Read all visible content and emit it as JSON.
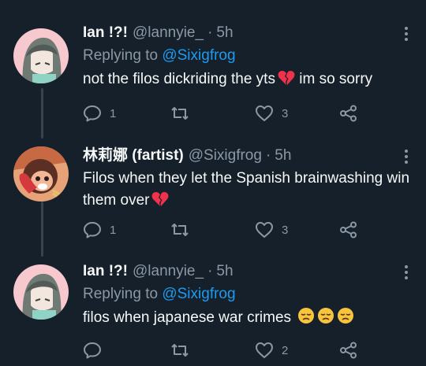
{
  "colors": {
    "background": "#15202b",
    "text": "#f7f9f9",
    "muted": "#8b98a5",
    "link": "#1d9bf0",
    "thread_line": "#38444d",
    "broken_heart": "#f0324c",
    "disappointed_face": "#f8c33d"
  },
  "tweets": [
    {
      "display_name": "Ian !?!",
      "handle": "@lannyie_",
      "separator": "·",
      "time": "5h",
      "replying_label": "Replying to",
      "replying_to": "@Sixigfrog",
      "text": "not the filos dickriding the yts",
      "emojis": [
        "broken-heart"
      ],
      "trailing_text": " im so sorry",
      "reply_count": "1",
      "retweet_count": "",
      "like_count": "3"
    },
    {
      "display_name": "林莉娜 (fartist)",
      "handle": "@Sixigfrog",
      "separator": "·",
      "time": "5h",
      "text": "Filos when they let the Spanish brainwashing win them over",
      "emojis": [
        "broken-heart"
      ],
      "reply_count": "1",
      "retweet_count": "",
      "like_count": "3"
    },
    {
      "display_name": "Ian !?!",
      "handle": "@lannyie_",
      "separator": "·",
      "time": "5h",
      "replying_label": "Replying to",
      "replying_to": "@Sixigfrog",
      "text": "filos when japanese war crimes ",
      "emojis": [
        "disappointed-face",
        "disappointed-face",
        "disappointed-face"
      ],
      "reply_count": "",
      "retweet_count": "",
      "like_count": "2"
    }
  ]
}
